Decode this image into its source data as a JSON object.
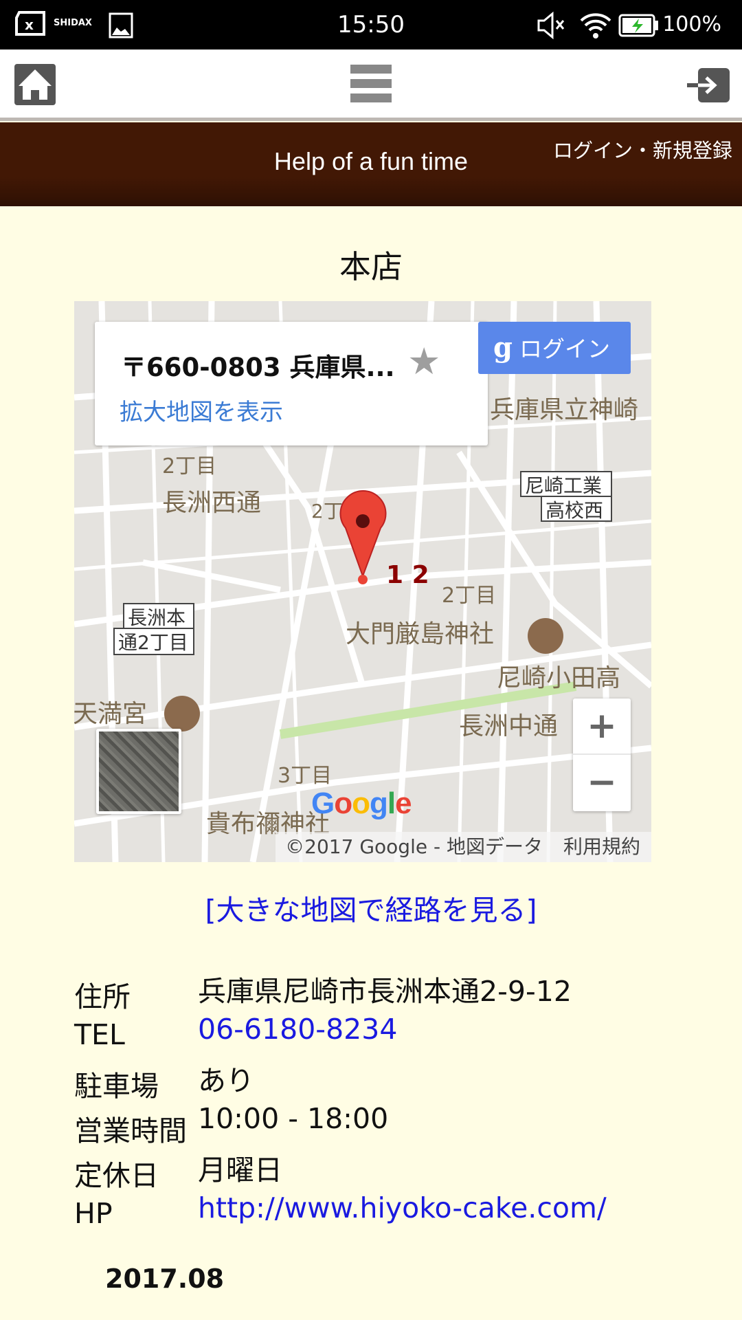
{
  "status_bar": {
    "time": "15:50",
    "battery": "100%",
    "carrier_logo": "SHIDAX",
    "icons": [
      "sim-x-icon",
      "gallery-icon",
      "mute-icon",
      "wifi-icon",
      "battery-charging-icon"
    ]
  },
  "toolbar": {
    "icons": [
      "home-icon",
      "hamburger-menu-icon",
      "login-arrow-icon"
    ]
  },
  "header": {
    "title": "Help of a fun time",
    "login_link": "ログイン・新規登録",
    "color": "#421805"
  },
  "shop": {
    "name": "本店"
  },
  "map": {
    "info_card": {
      "address": "〒660-0803 兵庫県...",
      "view_larger": "拡大地図を表示"
    },
    "google_login": "ログイン",
    "marker_label": "1 2",
    "labels": [
      "兵庫県立神崎",
      "2丁目",
      "長洲西通",
      "2丁",
      "尼崎工業",
      "高校西",
      "長洲本",
      "通2丁目",
      "2丁目",
      "大門厳島神社",
      "尼崎小田高",
      "天満宮",
      "長洲中通",
      "3丁目",
      "貴布禰神社"
    ],
    "zoom_in": "+",
    "zoom_out": "−",
    "logo": "Google",
    "copyright": "©2017 Google - 地図データ",
    "terms": "利用規約"
  },
  "route_link": "[大きな地図で経路を見る]",
  "info": [
    {
      "label": "住所",
      "value": "兵庫県尼崎市長洲本通2-9-12",
      "link": false
    },
    {
      "label": "TEL",
      "value": "06-6180-8234",
      "link": true
    },
    {
      "label": "駐車場",
      "value": "あり",
      "link": false
    },
    {
      "label": "営業時間",
      "value": "10:00 - 18:00",
      "link": false
    },
    {
      "label": "定休日",
      "value": "月曜日",
      "link": false
    },
    {
      "label": "HP",
      "value": "http://www.hiyoko-cake.com/",
      "link": true
    }
  ],
  "date": "2017.08"
}
